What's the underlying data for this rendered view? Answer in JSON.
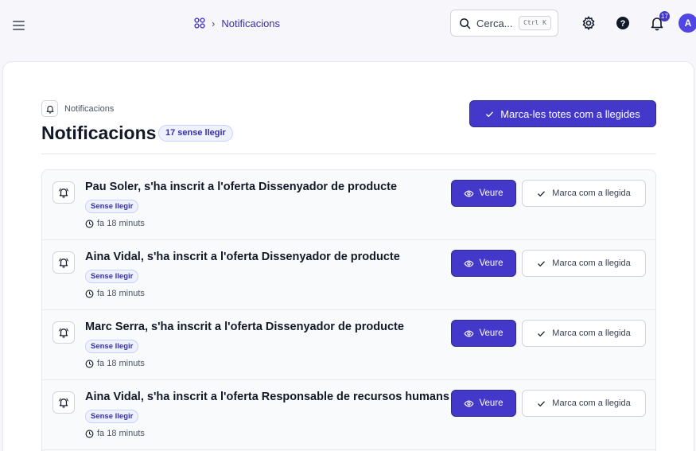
{
  "header": {
    "breadcrumb": "Notificacions",
    "search_placeholder": "Cerca...",
    "search_shortcut": "Ctrl K",
    "notification_count": "17",
    "avatar_initial": "A"
  },
  "page": {
    "section_label": "Notificacions",
    "title": "Notificacions",
    "unread_pill": "17 sense llegir",
    "mark_all_label": "Marca-les totes com a llegides"
  },
  "notifications": [
    {
      "title": "Pau Soler, s'ha inscrit a l'oferta Dissenyador de producte",
      "badge": "Sense llegir",
      "time": "fa 18 minuts",
      "view_label": "Veure",
      "mark_label": "Marca com a llegida"
    },
    {
      "title": "Aina Vidal, s'ha inscrit a l'oferta Dissenyador de producte",
      "badge": "Sense llegir",
      "time": "fa 18 minuts",
      "view_label": "Veure",
      "mark_label": "Marca com a llegida"
    },
    {
      "title": "Marc Serra, s'ha inscrit a l'oferta Dissenyador de producte",
      "badge": "Sense llegir",
      "time": "fa 18 minuts",
      "view_label": "Veure",
      "mark_label": "Marca com a llegida"
    },
    {
      "title": "Aina Vidal, s'ha inscrit a l'oferta Responsable de recursos humans",
      "badge": "Sense llegir",
      "time": "fa 18 minuts",
      "view_label": "Veure",
      "mark_label": "Marca com a llegida"
    }
  ],
  "colors": {
    "accent": "#4338ca",
    "accent_soft": "#eef2ff",
    "border": "#e5e7eb"
  }
}
